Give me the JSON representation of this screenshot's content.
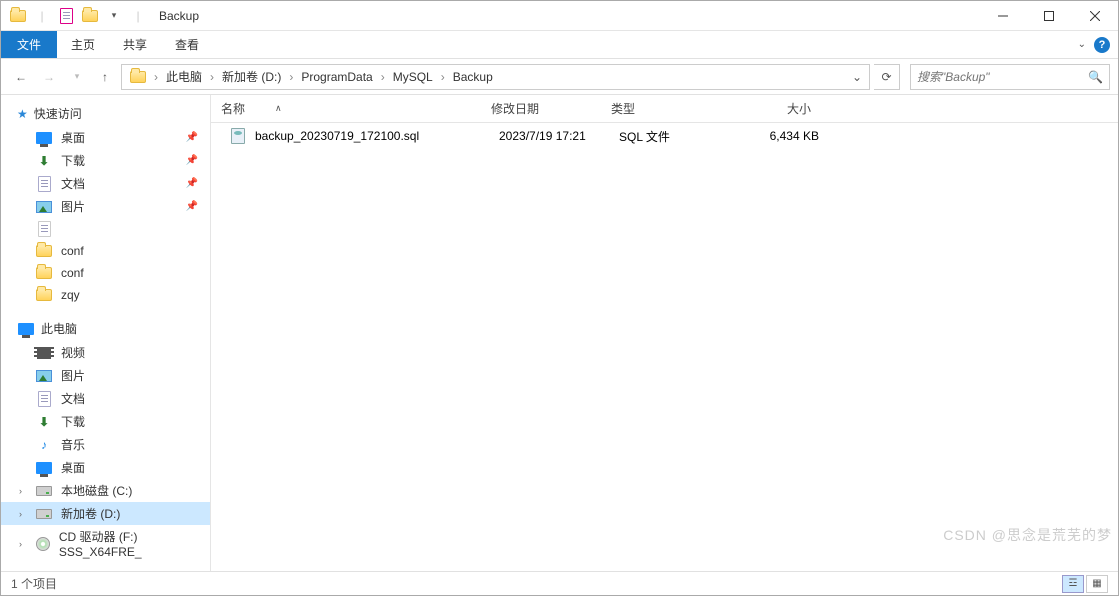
{
  "window": {
    "title": "Backup"
  },
  "ribbon": {
    "file": "文件",
    "tabs": [
      "主页",
      "共享",
      "查看"
    ]
  },
  "breadcrumb": {
    "items": [
      "此电脑",
      "新加卷 (D:)",
      "ProgramData",
      "MySQL",
      "Backup"
    ]
  },
  "search": {
    "placeholder": "搜索\"Backup\""
  },
  "sidebar": {
    "quick_access": "快速访问",
    "quick_items": [
      {
        "label": "桌面",
        "icon": "desktop",
        "pinned": true
      },
      {
        "label": "下载",
        "icon": "download",
        "pinned": true
      },
      {
        "label": "文档",
        "icon": "doc",
        "pinned": true
      },
      {
        "label": "图片",
        "icon": "pic",
        "pinned": true
      },
      {
        "label": "",
        "icon": "blank",
        "pinned": false
      },
      {
        "label": "conf",
        "icon": "folder",
        "pinned": false
      },
      {
        "label": "conf",
        "icon": "folder",
        "pinned": false
      },
      {
        "label": "zqy",
        "icon": "folder",
        "pinned": false
      }
    ],
    "this_pc": "此电脑",
    "pc_items": [
      {
        "label": "视频",
        "icon": "video"
      },
      {
        "label": "图片",
        "icon": "pic"
      },
      {
        "label": "文档",
        "icon": "doc"
      },
      {
        "label": "下载",
        "icon": "download"
      },
      {
        "label": "音乐",
        "icon": "music"
      },
      {
        "label": "桌面",
        "icon": "desktop"
      },
      {
        "label": "本地磁盘 (C:)",
        "icon": "drive"
      },
      {
        "label": "新加卷 (D:)",
        "icon": "drive",
        "selected": true
      },
      {
        "label": "CD 驱动器 (F:) SSS_X64FRE_",
        "icon": "cd"
      }
    ]
  },
  "columns": {
    "name": "名称",
    "modified": "修改日期",
    "type": "类型",
    "size": "大小"
  },
  "files": [
    {
      "name": "backup_20230719_172100.sql",
      "modified": "2023/7/19 17:21",
      "type": "SQL 文件",
      "size": "6,434 KB"
    }
  ],
  "statusbar": {
    "count": "1 个项目"
  },
  "watermark": "CSDN @思念是荒芜的梦"
}
